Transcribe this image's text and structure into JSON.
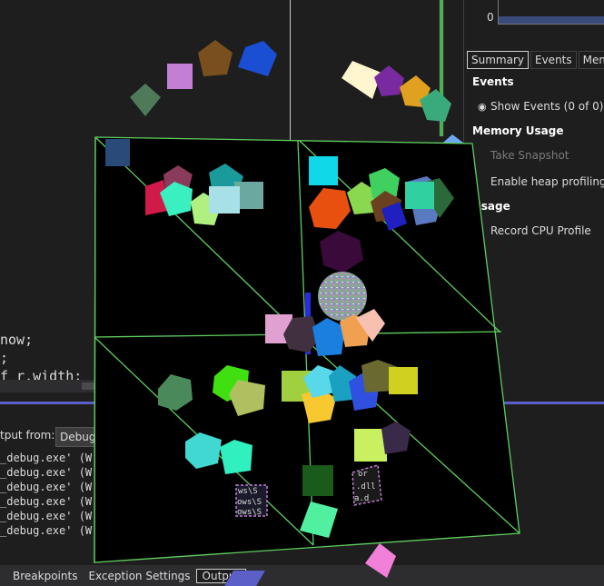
{
  "editor": {
    "code_lines": [
      {
        "text": "now;"
      },
      {
        "text": ";"
      },
      {
        "text": "f r.width;"
      }
    ]
  },
  "diagnostics": {
    "chart_zero_label": "0",
    "tabs": [
      {
        "label": "Summary",
        "active": true
      },
      {
        "label": "Events",
        "active": false
      },
      {
        "label": "Memo",
        "active": false
      }
    ],
    "events_heading": "Events",
    "show_events_label": "Show Events (0 of 0)",
    "memory_heading": "Memory Usage",
    "take_snapshot_label": "Take Snapshot",
    "enable_heap_label": "Enable heap profiling",
    "cpu_heading": "Usage",
    "record_cpu_label": "Record CPU Profile"
  },
  "output": {
    "from_label": "tput from:",
    "source_value": "Debug",
    "lines": [
      "_debug.exe' (W",
      "_debug.exe' (W",
      "_debug.exe' (W",
      "_debug.exe' (W",
      "_debug.exe' (W",
      "_debug.exe' (W"
    ]
  },
  "bottom_tabs": [
    {
      "label": "Breakpoints",
      "active": false
    },
    {
      "label": "Exception Settings",
      "active": false
    },
    {
      "label": "Output",
      "active": true
    }
  ],
  "scene_text": {
    "tile_a": [
      "ws\\S",
      "ows\\S",
      "ows\\S"
    ],
    "tile_b": [
      "or",
      ".dll",
      "a.d"
    ]
  },
  "colors": {
    "accent": "#5b5fc7",
    "wire": "#5fcf5f"
  }
}
